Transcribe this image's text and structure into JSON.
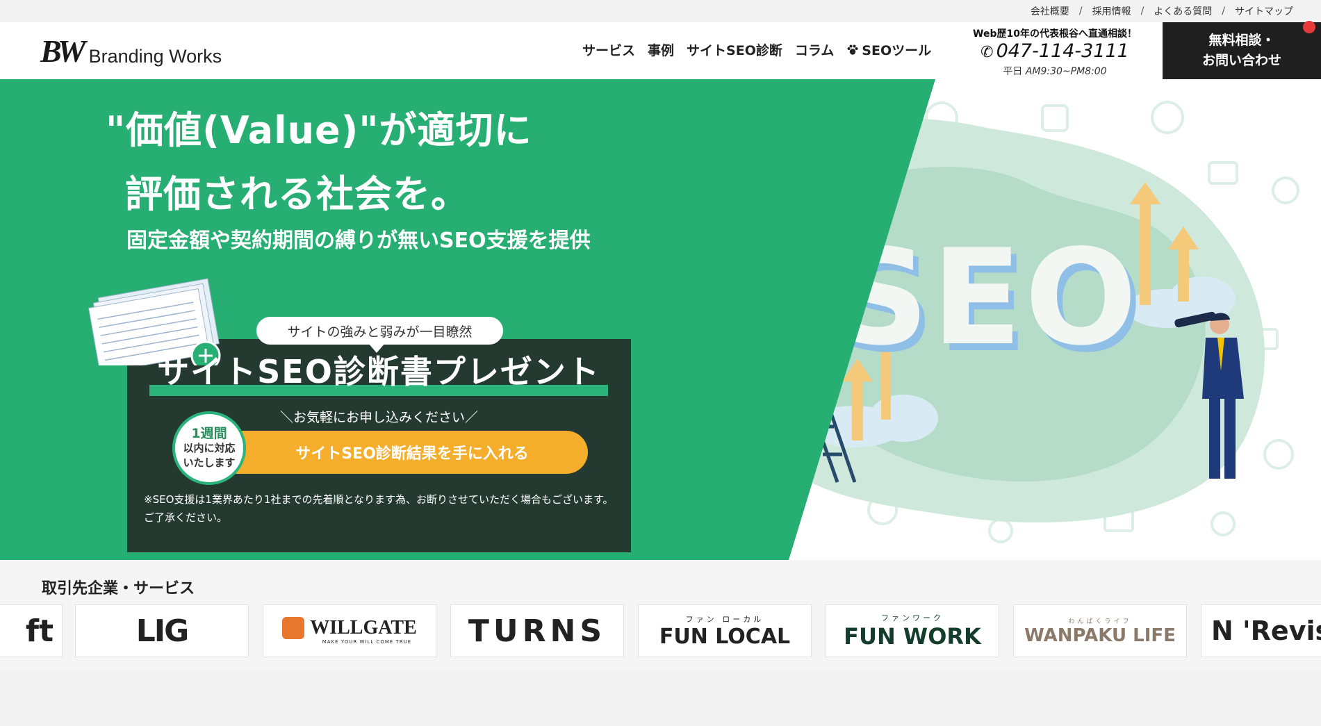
{
  "topbar": {
    "links": [
      "会社概要",
      "採用情報",
      "よくある質問",
      "サイトマップ"
    ],
    "separator": "/"
  },
  "header": {
    "logo_mark": "BW",
    "logo_text": "Branding Works",
    "nav": [
      "サービス",
      "事例",
      "サイトSEO診断",
      "コラム",
      "SEOツール"
    ],
    "contact_lead": "Web歴10年の代表根谷へ直通相談！",
    "phone": "047-114-3111",
    "hours_label": "平日",
    "hours": "AM9:30~PM8:00",
    "cta_line1": "無料相談・",
    "cta_line2": "お問い合わせ"
  },
  "hero": {
    "headline_line1": "\"価値(Value)\"が適切に",
    "headline_line2": "評価される社会を。",
    "subhead": "固定金額や契約期間の縛りが無いSEO支援を提供",
    "bubble": "サイトの強みと弱みが一目瞭然",
    "present_title": "サイトSEO診断書プレゼント",
    "present_sub": "＼お気軽にお申し込みください／",
    "badge_line1": "1週間",
    "badge_line2": "以内に対応",
    "badge_line3": "いたします",
    "button_label": "サイトSEO診断結果を手に入れる",
    "note": "※SEO支援は1業界あたり1社までの先着順となります為、お断りさせていただく場合もございます。ご了承ください。",
    "illustration_text": "SEO"
  },
  "clients": {
    "title": "取引先企業・サービス",
    "items": [
      {
        "name": "ft"
      },
      {
        "name": "LIG"
      },
      {
        "name": "WILLGATE",
        "sub": "MAKE YOUR WILL COME TRUE"
      },
      {
        "name": "TURNS"
      },
      {
        "name": "FUN LOCAL",
        "sub": "ファン ローカル"
      },
      {
        "name": "FUN WORK",
        "sub": "ファンワーク"
      },
      {
        "name": "WANPAKU LIFE",
        "sub": "わんぱくライフ"
      },
      {
        "name": "N 'Revis"
      }
    ]
  },
  "colors": {
    "green": "#27ae72",
    "dark_box": "#243a31",
    "orange": "#f5ae2b",
    "header_dark": "#1f1f1f"
  }
}
